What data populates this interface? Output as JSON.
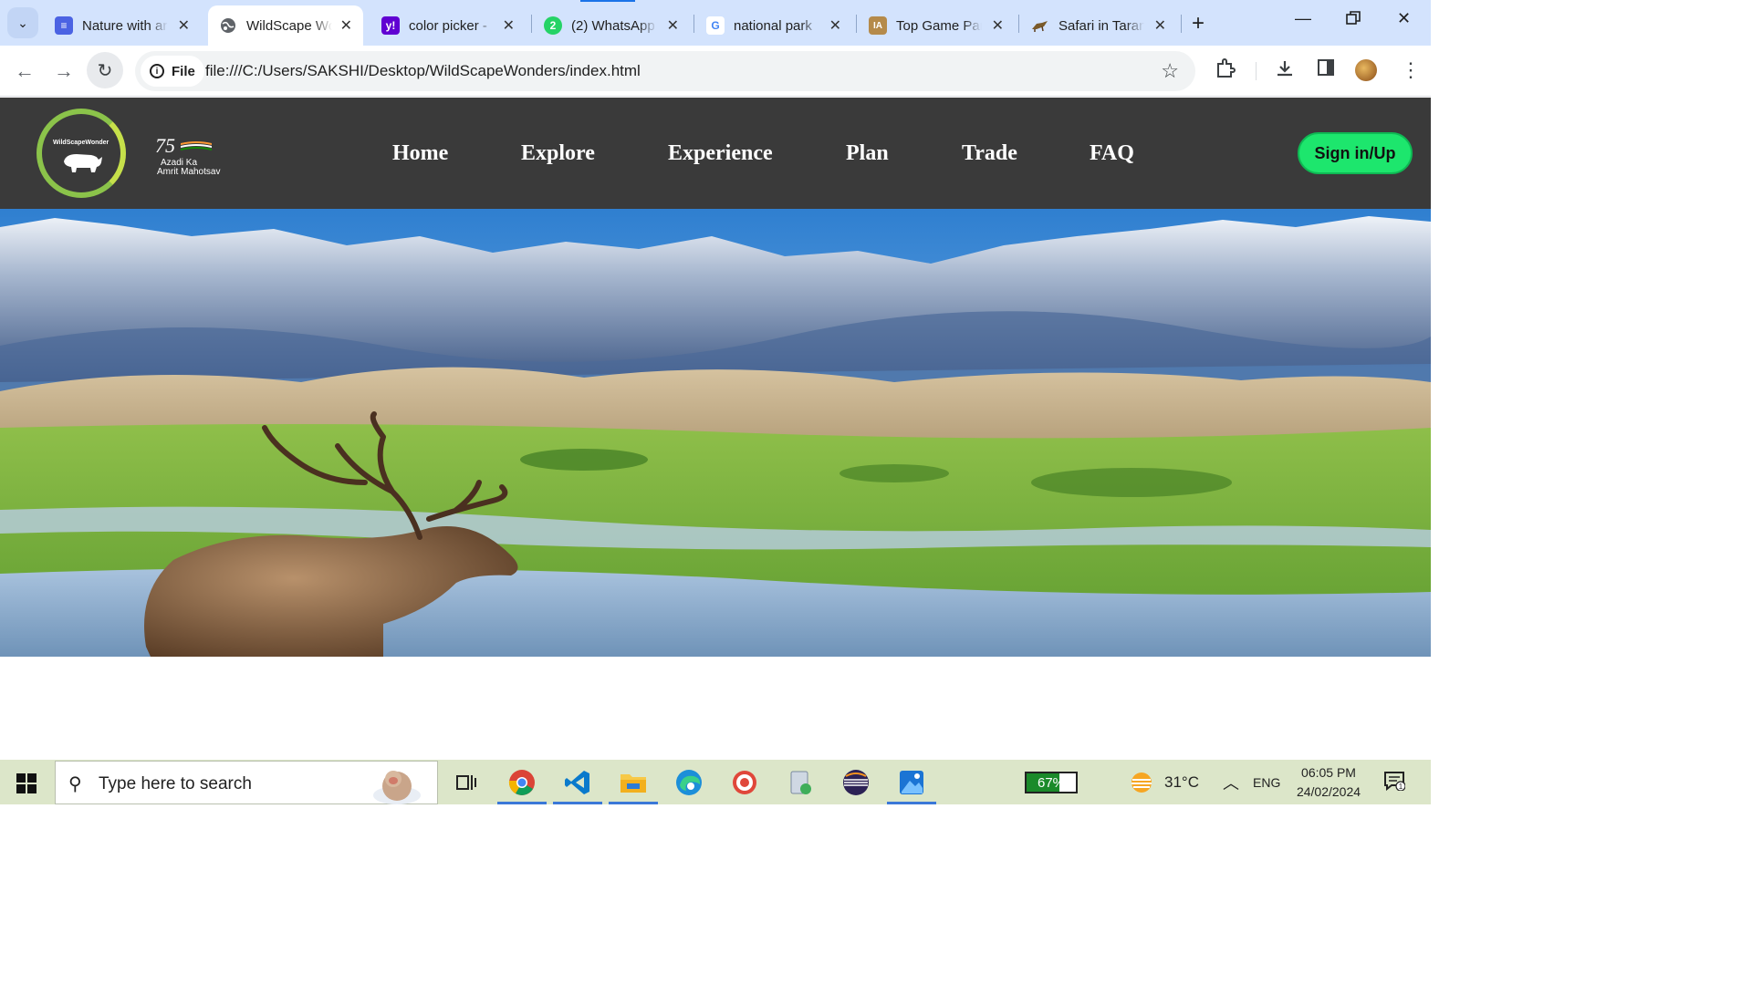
{
  "browser": {
    "tabs": [
      {
        "title": "Nature with ar",
        "favicon": "forms-icon",
        "color": "#4b63e3",
        "active": false
      },
      {
        "title": "WildScape Wo",
        "favicon": "globe-icon",
        "color": "#5f6368",
        "active": true
      },
      {
        "title": "color picker -",
        "favicon": "yahoo-icon",
        "color": "#6001d2",
        "active": false
      },
      {
        "title": "(2) WhatsApp",
        "favicon": "whatsapp-icon",
        "color": "#25d366",
        "active": false
      },
      {
        "title": "national park",
        "favicon": "google-icon",
        "color": "#4285f4",
        "active": false
      },
      {
        "title": "Top Game Par",
        "favicon": "ia-icon",
        "color": "#b58a4a",
        "active": false
      },
      {
        "title": "Safari in Taran",
        "favicon": "safari-icon",
        "color": "#7a5a2a",
        "active": false
      }
    ],
    "whatsapp_badge": "2",
    "ia_badge": "IA",
    "security_chip": "File",
    "url": "file:///C:/Users/SAKSHI/Desktop/WildScapeWonders/index.html"
  },
  "site": {
    "logo_text": "WildScapeWonder",
    "azadi": {
      "number": "75",
      "line1": "Azadi Ka",
      "line2": "Amrit Mahotsav"
    },
    "nav": [
      "Home",
      "Explore",
      "Experience",
      "Plan",
      "Trade",
      "FAQ"
    ],
    "signin_label": "Sign in/Up",
    "accent": "#1de66d",
    "header_bg": "#3a3a3a"
  },
  "taskbar": {
    "search_placeholder": "Type here to search",
    "apps": [
      "task-view-icon",
      "chrome-icon",
      "vscode-icon",
      "file-explorer-icon",
      "edge-icon",
      "target-app-icon",
      "notepad-app-icon",
      "eclipse-icon",
      "photos-icon"
    ],
    "battery": "67%",
    "battery_level": 0.67,
    "temperature": "31°C",
    "language": "ENG",
    "time": "06:05 PM",
    "date": "24/02/2024",
    "notification_count": "1"
  }
}
